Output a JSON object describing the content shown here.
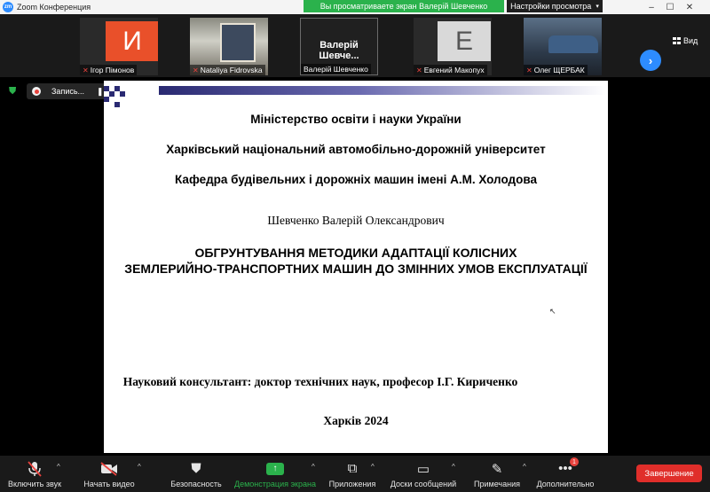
{
  "window": {
    "title": "Zoom Конференция",
    "logo": "zm"
  },
  "share_banner": "Вы просматриваете экран Валерій Шевченко",
  "view_settings": {
    "label": "Настройки просмотра"
  },
  "gallery": {
    "tiles": [
      {
        "name": "Ігор Пімонов",
        "initial": "И",
        "avatar_color": "#e9502a"
      },
      {
        "name": "Nataliya Fidrovska"
      },
      {
        "name": "Валерій Шевченко",
        "big_name": "Валерій Шевче..."
      },
      {
        "name": "Евгений Макопух",
        "initial": "E",
        "avatar_color": "#d9d9d9"
      },
      {
        "name": "Олег ЩЕРБАК"
      }
    ],
    "view_label": "Вид"
  },
  "recording": {
    "label": "Запись..."
  },
  "slide": {
    "line1": "Міністерство освіти і науки України",
    "line2": "Харківський національний автомобільно-дорожній університет",
    "line3": "Кафедра будівельних і дорожніх машин імені А.М. Холодова",
    "author": "Шевченко Валерій Олександрович",
    "title1": "ОБГРУНТУВАННЯ МЕТОДИКИ АДАПТАЦІЇ КОЛІСНИХ",
    "title2": "ЗЕМЛЕРИЙНО-ТРАНСПОРТНИХ МАШИН ДО ЗМІННИХ УМОВ ЕКСПЛУАТАЦІЇ",
    "consultant": "Науковий консультант: доктор технічних наук, професор І.Г. Кириченко",
    "city_year": "Харків 2024"
  },
  "toolbar": {
    "audio": "Включить звук",
    "video": "Начать видео",
    "security": "Безопасность",
    "share": "Демонстрация экрана",
    "apps": "Приложения",
    "whiteboards": "Доски сообщений",
    "annotate": "Примечания",
    "more": "Дополнительно",
    "more_badge": "1",
    "end": "Завершение"
  },
  "colors": {
    "accent": "#2d8cff",
    "share_green": "#2bb24c",
    "end_red": "#e02e2a",
    "slide_bar": "#2a2a72"
  }
}
